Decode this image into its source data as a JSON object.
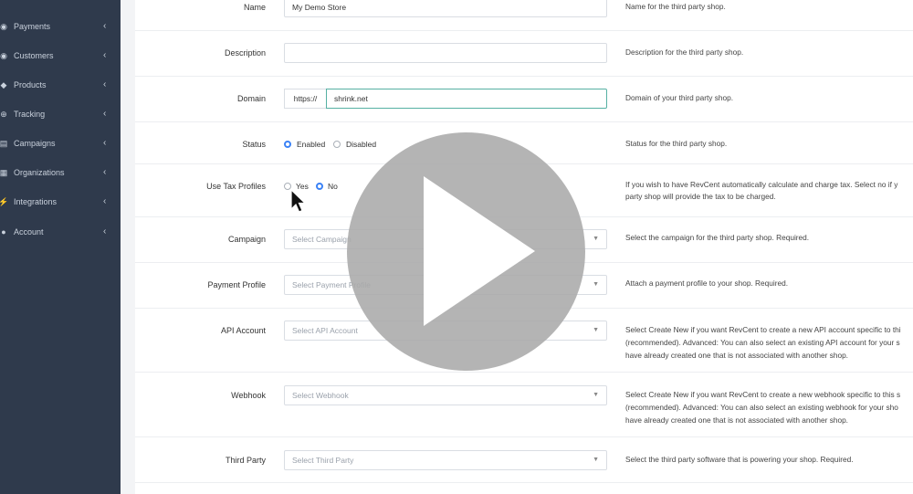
{
  "sidebar": {
    "items": [
      {
        "label": "Payments",
        "icon": "globe-icon"
      },
      {
        "label": "Customers",
        "icon": "user-circle-icon"
      },
      {
        "label": "Products",
        "icon": "tag-icon"
      },
      {
        "label": "Tracking",
        "icon": "crosshair-icon"
      },
      {
        "label": "Campaigns",
        "icon": "map-icon"
      },
      {
        "label": "Organizations",
        "icon": "building-icon"
      },
      {
        "label": "Integrations",
        "icon": "plug-icon"
      },
      {
        "label": "Account",
        "icon": "person-icon"
      }
    ]
  },
  "form": {
    "name": {
      "label": "Name",
      "value": "My Demo Store",
      "help": "Name for the third party shop."
    },
    "description": {
      "label": "Description",
      "value": "",
      "help": "Description for the third party shop."
    },
    "domain": {
      "label": "Domain",
      "prefix": "https://",
      "value": "shrink.net",
      "help": "Domain of your third party shop."
    },
    "status": {
      "label": "Status",
      "options": [
        "Enabled",
        "Disabled"
      ],
      "selected": "Enabled",
      "help": "Status for the third party shop."
    },
    "tax": {
      "label": "Use Tax Profiles",
      "options": [
        "Yes",
        "No"
      ],
      "selected": "No",
      "help_line1": "If you wish to have RevCent automatically calculate and charge tax. Select no if y",
      "help_line2": "party shop will provide the tax to be charged."
    },
    "campaign": {
      "label": "Campaign",
      "placeholder": "Select Campaign",
      "help": "Select the campaign for the third party shop. Required."
    },
    "payment_profile": {
      "label": "Payment Profile",
      "placeholder": "Select Payment Profile",
      "help": "Attach a payment profile to your shop. Required."
    },
    "api_account": {
      "label": "API Account",
      "placeholder": "Select API Account",
      "help_line1": "Select Create New if you want RevCent to create a new API account specific to thi",
      "help_line2": "(recommended). Advanced: You can also select an existing API account for your s",
      "help_line3": "have already created one that is not associated with another shop."
    },
    "webhook": {
      "label": "Webhook",
      "placeholder": "Select Webhook",
      "help_line1": "Select Create New if you want RevCent to create a new webhook specific to this s",
      "help_line2": "(recommended). Advanced: You can also select an existing webhook for your sho",
      "help_line3": "have already created one that is not associated with another shop."
    },
    "third_party": {
      "label": "Third Party",
      "placeholder": "Select Third Party",
      "help": "Select the third party software that is powering your shop. Required."
    }
  },
  "overlay": {
    "icon": "play-icon"
  },
  "colors": {
    "sidebar": "#2f3a4c",
    "accent": "#3b82f6",
    "focus_border": "#56b0a3",
    "overlay": "#aaaaaa"
  }
}
